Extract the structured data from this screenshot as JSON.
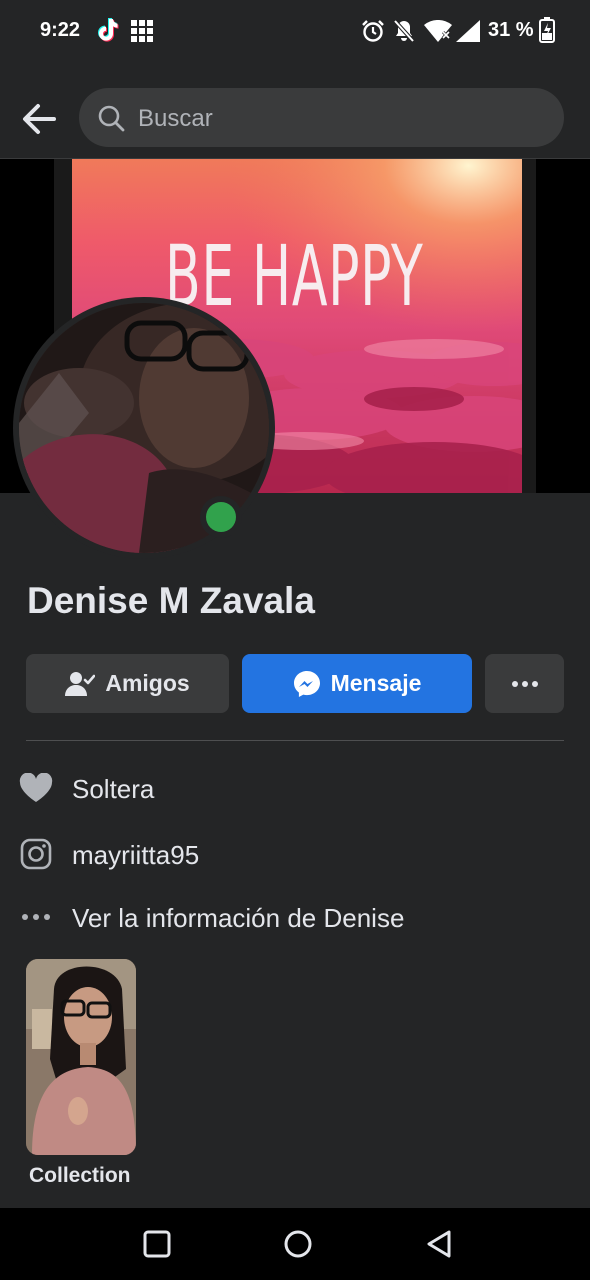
{
  "status_bar": {
    "time": "9:22",
    "battery": "31 %",
    "icons": [
      "tiktok-icon",
      "grid-icon",
      "alarm-icon",
      "mute-icon",
      "wifi-icon",
      "signal-icon",
      "battery-icon"
    ]
  },
  "header": {
    "back_icon": "arrow-left-icon",
    "search_placeholder": "Buscar"
  },
  "cover": {
    "text": "BE HAPPY"
  },
  "profile": {
    "name": "Denise M Zavala",
    "online": true,
    "online_color": "#31a24c"
  },
  "actions": {
    "friends_label": "Amigos",
    "message_label": "Mensaje",
    "more_label": "more-options"
  },
  "info": [
    {
      "icon": "heart-icon",
      "text": "Soltera"
    },
    {
      "icon": "instagram-icon",
      "text": "mayriitta95"
    },
    {
      "icon": "ellipsis-icon",
      "text": "Ver la información de Denise"
    }
  ],
  "featured": {
    "label": "Collection"
  },
  "colors": {
    "background": "#242526",
    "accent": "#2374e1",
    "button": "#3a3b3c",
    "text": "#e4e6eb"
  }
}
